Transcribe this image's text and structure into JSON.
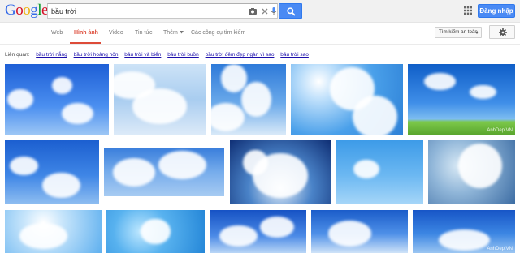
{
  "header": {
    "logo_letters": [
      "G",
      "o",
      "o",
      "g",
      "l",
      "e"
    ],
    "logo_colors": [
      "#3369e8",
      "#d50f25",
      "#eeb211",
      "#3369e8",
      "#009925",
      "#d50f25"
    ],
    "search_value": "bầu trời",
    "signin_label": "Đăng nhập"
  },
  "nav": {
    "tabs": [
      {
        "label": "Web",
        "active": false
      },
      {
        "label": "Hình ảnh",
        "active": true
      },
      {
        "label": "Video",
        "active": false
      },
      {
        "label": "Tin tức",
        "active": false
      },
      {
        "label": "Thêm",
        "active": false
      },
      {
        "label": "Các công cụ tìm kiếm",
        "active": false
      }
    ],
    "safesearch_label": "Tìm kiếm an toàn"
  },
  "related": {
    "label": "Liên quan:",
    "links": [
      "bầu trời nắng",
      "bầu trời hoàng hôn",
      "bầu trời và biển",
      "bầu trời buồn",
      "bầu trời đêm đẹp ngàn vì sao",
      "bầu trời sao"
    ]
  },
  "images": {
    "count": 15,
    "watermark": "AnhDep.VN"
  },
  "colors": {
    "accent_blue": "#4a8af4",
    "active_tab": "#dd4b39",
    "link": "#1a0dab"
  }
}
